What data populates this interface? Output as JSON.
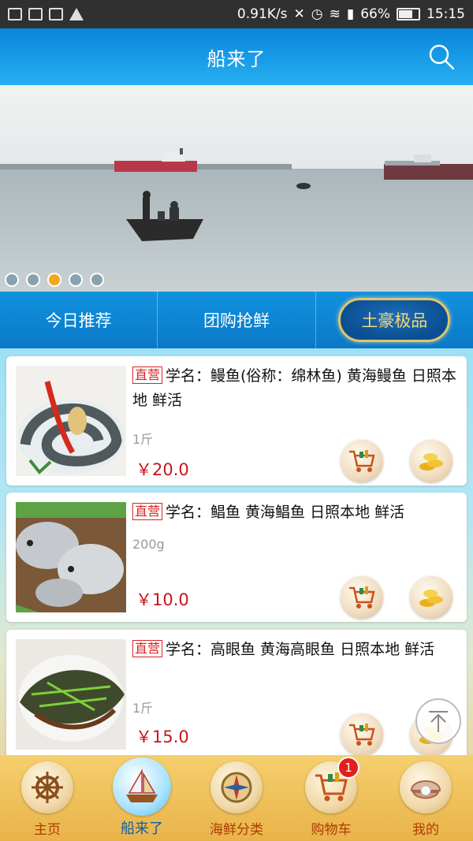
{
  "status_bar": {
    "speed": "0.91K/s",
    "battery": "66%",
    "time": "15:15"
  },
  "header": {
    "title": "船来了"
  },
  "banner": {
    "active_slide_index": 2,
    "slide_count": 5
  },
  "tabs": [
    {
      "label": "今日推荐",
      "active": false
    },
    {
      "label": "团购抢鲜",
      "active": false
    },
    {
      "label": "土豪极品",
      "active": true
    }
  ],
  "products": [
    {
      "badge": "直营",
      "title": "学名：鳗鱼(俗称：绵林鱼) 黄海鳗鱼 日照本地 鲜活",
      "weight": "1斤",
      "price": "￥20.0",
      "image": "eel-dish"
    },
    {
      "badge": "直营",
      "title": "学名：鲳鱼 黄海鲳鱼 日照本地 鲜活",
      "weight": "200g",
      "price": "￥10.0",
      "image": "pomfret-fish"
    },
    {
      "badge": "直营",
      "title": "学名：高眼鱼 黄海高眼鱼 日照本地 鲜活",
      "weight": "1斤",
      "price": "￥15.0",
      "image": "flatfish-dish"
    }
  ],
  "bottom_nav": [
    {
      "label": "主页",
      "icon": "ship-wheel-icon"
    },
    {
      "label": "船来了",
      "icon": "sailboat-icon",
      "active": true
    },
    {
      "label": "海鲜分类",
      "icon": "compass-icon"
    },
    {
      "label": "购物车",
      "icon": "cart-icon",
      "badge": "1"
    },
    {
      "label": "我的",
      "icon": "shell-pearl-icon"
    }
  ],
  "colors": {
    "header_blue": "#1a9ee9",
    "price_red": "#c8151a",
    "nav_gold": "#f5cf6e",
    "active_tab_gold": "#e2c46b"
  }
}
